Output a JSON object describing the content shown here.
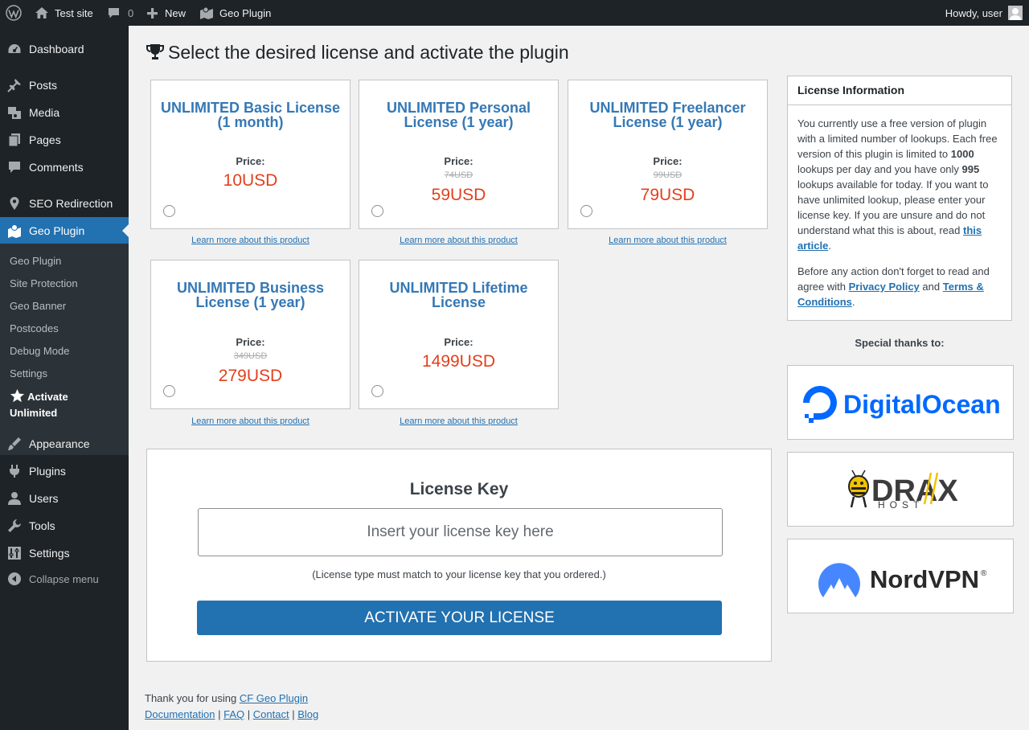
{
  "adminbar": {
    "site_name": "Test site",
    "comments_count": "0",
    "new_label": "New",
    "plugin_label": "Geo Plugin",
    "greeting": "Howdy, user"
  },
  "sidebar": {
    "items": [
      {
        "label": "Dashboard",
        "icon": "dashboard-icon"
      },
      {
        "label": "Posts",
        "icon": "pin-icon"
      },
      {
        "label": "Media",
        "icon": "media-icon"
      },
      {
        "label": "Pages",
        "icon": "pages-icon"
      },
      {
        "label": "Comments",
        "icon": "comment-icon"
      },
      {
        "label": "SEO Redirection",
        "icon": "location-icon"
      },
      {
        "label": "Geo Plugin",
        "icon": "map-icon"
      },
      {
        "label": "Appearance",
        "icon": "brush-icon"
      },
      {
        "label": "Plugins",
        "icon": "plug-icon"
      },
      {
        "label": "Users",
        "icon": "user-icon"
      },
      {
        "label": "Tools",
        "icon": "wrench-icon"
      },
      {
        "label": "Settings",
        "icon": "sliders-icon"
      }
    ],
    "submenu": [
      "Geo Plugin",
      "Site Protection",
      "Geo Banner",
      "Postcodes",
      "Debug Mode",
      "Settings"
    ],
    "submenu_active_line1": "Activate",
    "submenu_active_line2": "Unlimited",
    "collapse_label": "Collapse menu"
  },
  "main": {
    "title": "Select the desired license and activate the plugin",
    "price_label": "Price:",
    "learn_more": "Learn more about this product",
    "plans": [
      {
        "title": "UNLIMITED Basic License (1 month)",
        "old_price": "",
        "price": "10USD"
      },
      {
        "title": "UNLIMITED Personal License (1 year)",
        "old_price": "74USD",
        "price": "59USD"
      },
      {
        "title": "UNLIMITED Freelancer License (1 year)",
        "old_price": "99USD",
        "price": "79USD"
      },
      {
        "title": "UNLIMITED Business License (1 year)",
        "old_price": "349USD",
        "price": "279USD"
      },
      {
        "title": "UNLIMITED Lifetime License",
        "old_price": "",
        "price": "1499USD"
      }
    ],
    "license": {
      "heading": "License Key",
      "placeholder": "Insert your license key here",
      "value": "",
      "note": "(License type must match to your license key that you ordered.)",
      "button": "Activate your license"
    },
    "footer": {
      "thanks_prefix": "Thank you for using",
      "plugin_link": "CF Geo Plugin",
      "links": [
        "Documentation",
        "FAQ",
        "Contact",
        "Blog"
      ],
      "separator": "|"
    }
  },
  "info_panel": {
    "title": "License Information",
    "p1_text1": "You currently use a free version of plugin with a limited number of lookups. Each free version of this plugin is limited to",
    "limit": "1000",
    "p1_text2": "lookups per day and you have only",
    "remaining": "995",
    "p1_text3": "lookups available for today. If you want to have unlimited lookup, please enter your license key. If you are unsure and do not understand what this is about, read",
    "article_link": "this article",
    "p2_text1": "Before any action don't forget to read and agree with",
    "privacy_link": "Privacy Policy",
    "and": "and",
    "terms_link": "Terms & Conditions",
    "period": "."
  },
  "sponsors": {
    "heading": "Special thanks to:",
    "items": [
      {
        "name": "DigitalOcean",
        "color": "#0069ff"
      },
      {
        "name": "DRAX HOST",
        "color": "#3c3c3c"
      },
      {
        "name": "NordVPN",
        "color": "#4687ff"
      }
    ]
  },
  "colors": {
    "accent": "#2271b1",
    "plan_title": "#3578b5",
    "price": "#e2401c",
    "sidebar_bg": "#1d2327"
  }
}
